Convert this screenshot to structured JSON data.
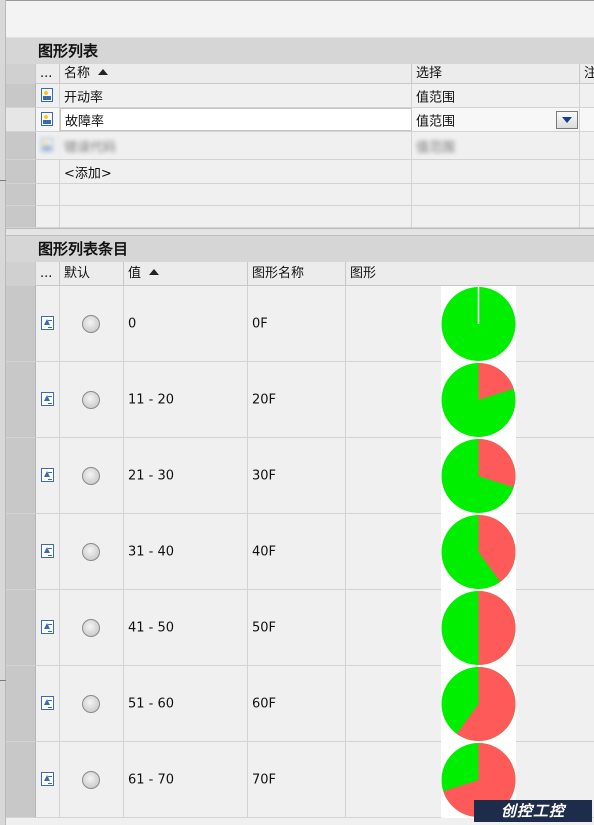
{
  "graphic_list_section": {
    "title": "图形列表",
    "columns": {
      "ellipsis": "...",
      "name": "名称",
      "selection": "选择",
      "comment": "注"
    },
    "rows": [
      {
        "name": "开动率",
        "selection": "值范围"
      },
      {
        "name": "故障率",
        "selection": "值范围"
      },
      {
        "name": "错误代码",
        "selection": "值范围"
      },
      {
        "name": "<添加>",
        "selection": ""
      }
    ]
  },
  "entries_section": {
    "title": "图形列表条目",
    "columns": {
      "ellipsis": "...",
      "default": "默认",
      "value": "值",
      "graphic_name": "图形名称",
      "graphic": "图形"
    },
    "rows": [
      {
        "value": "0",
        "graphic_name": "0F",
        "fill_fraction": 0.0
      },
      {
        "value": "11 - 20",
        "graphic_name": "20F",
        "fill_fraction": 0.2
      },
      {
        "value": "21 - 30",
        "graphic_name": "30F",
        "fill_fraction": 0.3
      },
      {
        "value": "31 - 40",
        "graphic_name": "40F",
        "fill_fraction": 0.4
      },
      {
        "value": "41 - 50",
        "graphic_name": "50F",
        "fill_fraction": 0.5
      },
      {
        "value": "51 - 60",
        "graphic_name": "60F",
        "fill_fraction": 0.6
      },
      {
        "value": "61 - 70",
        "graphic_name": "70F",
        "fill_fraction": 0.7
      }
    ]
  },
  "colors": {
    "pie_green": "#00ee00",
    "pie_red": "#ff5a5a",
    "selected_row": "#ffffff"
  },
  "icons": {
    "list_item": "image-list-icon",
    "entry_item": "graphic-entry-icon",
    "dropdown": "chevron-down-icon",
    "default_radio": "radio-button-icon"
  },
  "watermark": {
    "text": "创控工控"
  }
}
